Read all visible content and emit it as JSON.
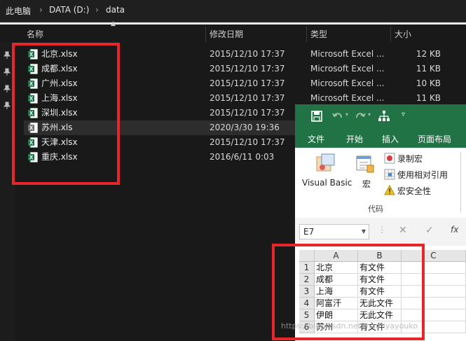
{
  "breadcrumb": {
    "root": "此电脑",
    "drive": "DATA (D:)",
    "folder": "data",
    "separator": "›"
  },
  "columns": {
    "name": "名称",
    "modified": "修改日期",
    "type": "类型",
    "size": "大小"
  },
  "files": [
    {
      "name": "北京.xlsx",
      "modified": "2015/12/10 17:37",
      "type": "Microsoft Excel ...",
      "size": "12 KB"
    },
    {
      "name": "成都.xlsx",
      "modified": "2015/12/10 17:37",
      "type": "Microsoft Excel ...",
      "size": "11 KB"
    },
    {
      "name": "广州.xlsx",
      "modified": "2015/12/10 17:37",
      "type": "Microsoft Excel ...",
      "size": "10 KB"
    },
    {
      "name": "上海.xlsx",
      "modified": "2015/12/10 17:37",
      "type": "Microsoft Excel ...",
      "size": "11 KB"
    },
    {
      "name": "深圳.xlsx",
      "modified": "2015/12/10 17:37",
      "type": "",
      "size": ""
    },
    {
      "name": "苏州.xls",
      "modified": "2020/3/30 19:36",
      "type": "",
      "size": ""
    },
    {
      "name": "天津.xlsx",
      "modified": "2015/12/10 17:37",
      "type": "",
      "size": ""
    },
    {
      "name": "重庆.xlsx",
      "modified": "2016/6/11 0:03",
      "type": "",
      "size": ""
    }
  ],
  "excel": {
    "tabs": [
      "文件",
      "开始",
      "插入",
      "页面布局"
    ],
    "ribbon": {
      "visual_basic": "Visual Basic",
      "macros": "宏",
      "record_macro": "录制宏",
      "use_relative": "使用相对引用",
      "macro_security": "宏安全性",
      "group_label": "代码"
    },
    "name_box": "E7",
    "fx": "fx",
    "col_headers": [
      "A",
      "B",
      "C"
    ],
    "rows": [
      {
        "n": "1",
        "a": "北京",
        "b": "有文件"
      },
      {
        "n": "2",
        "a": "成都",
        "b": "有文件"
      },
      {
        "n": "3",
        "a": "上海",
        "b": "有文件"
      },
      {
        "n": "4",
        "a": "阿富汗",
        "b": "无此文件"
      },
      {
        "n": "5",
        "a": "伊朗",
        "b": "无此文件"
      },
      {
        "n": "6",
        "a": "苏州",
        "b": "有文件"
      }
    ]
  },
  "watermark": "https://blog.csdn.net/mamiyayouko",
  "colors": {
    "accent_excel": "#217346",
    "highlight": "#e8262a",
    "explorer_bg": "#191919"
  }
}
